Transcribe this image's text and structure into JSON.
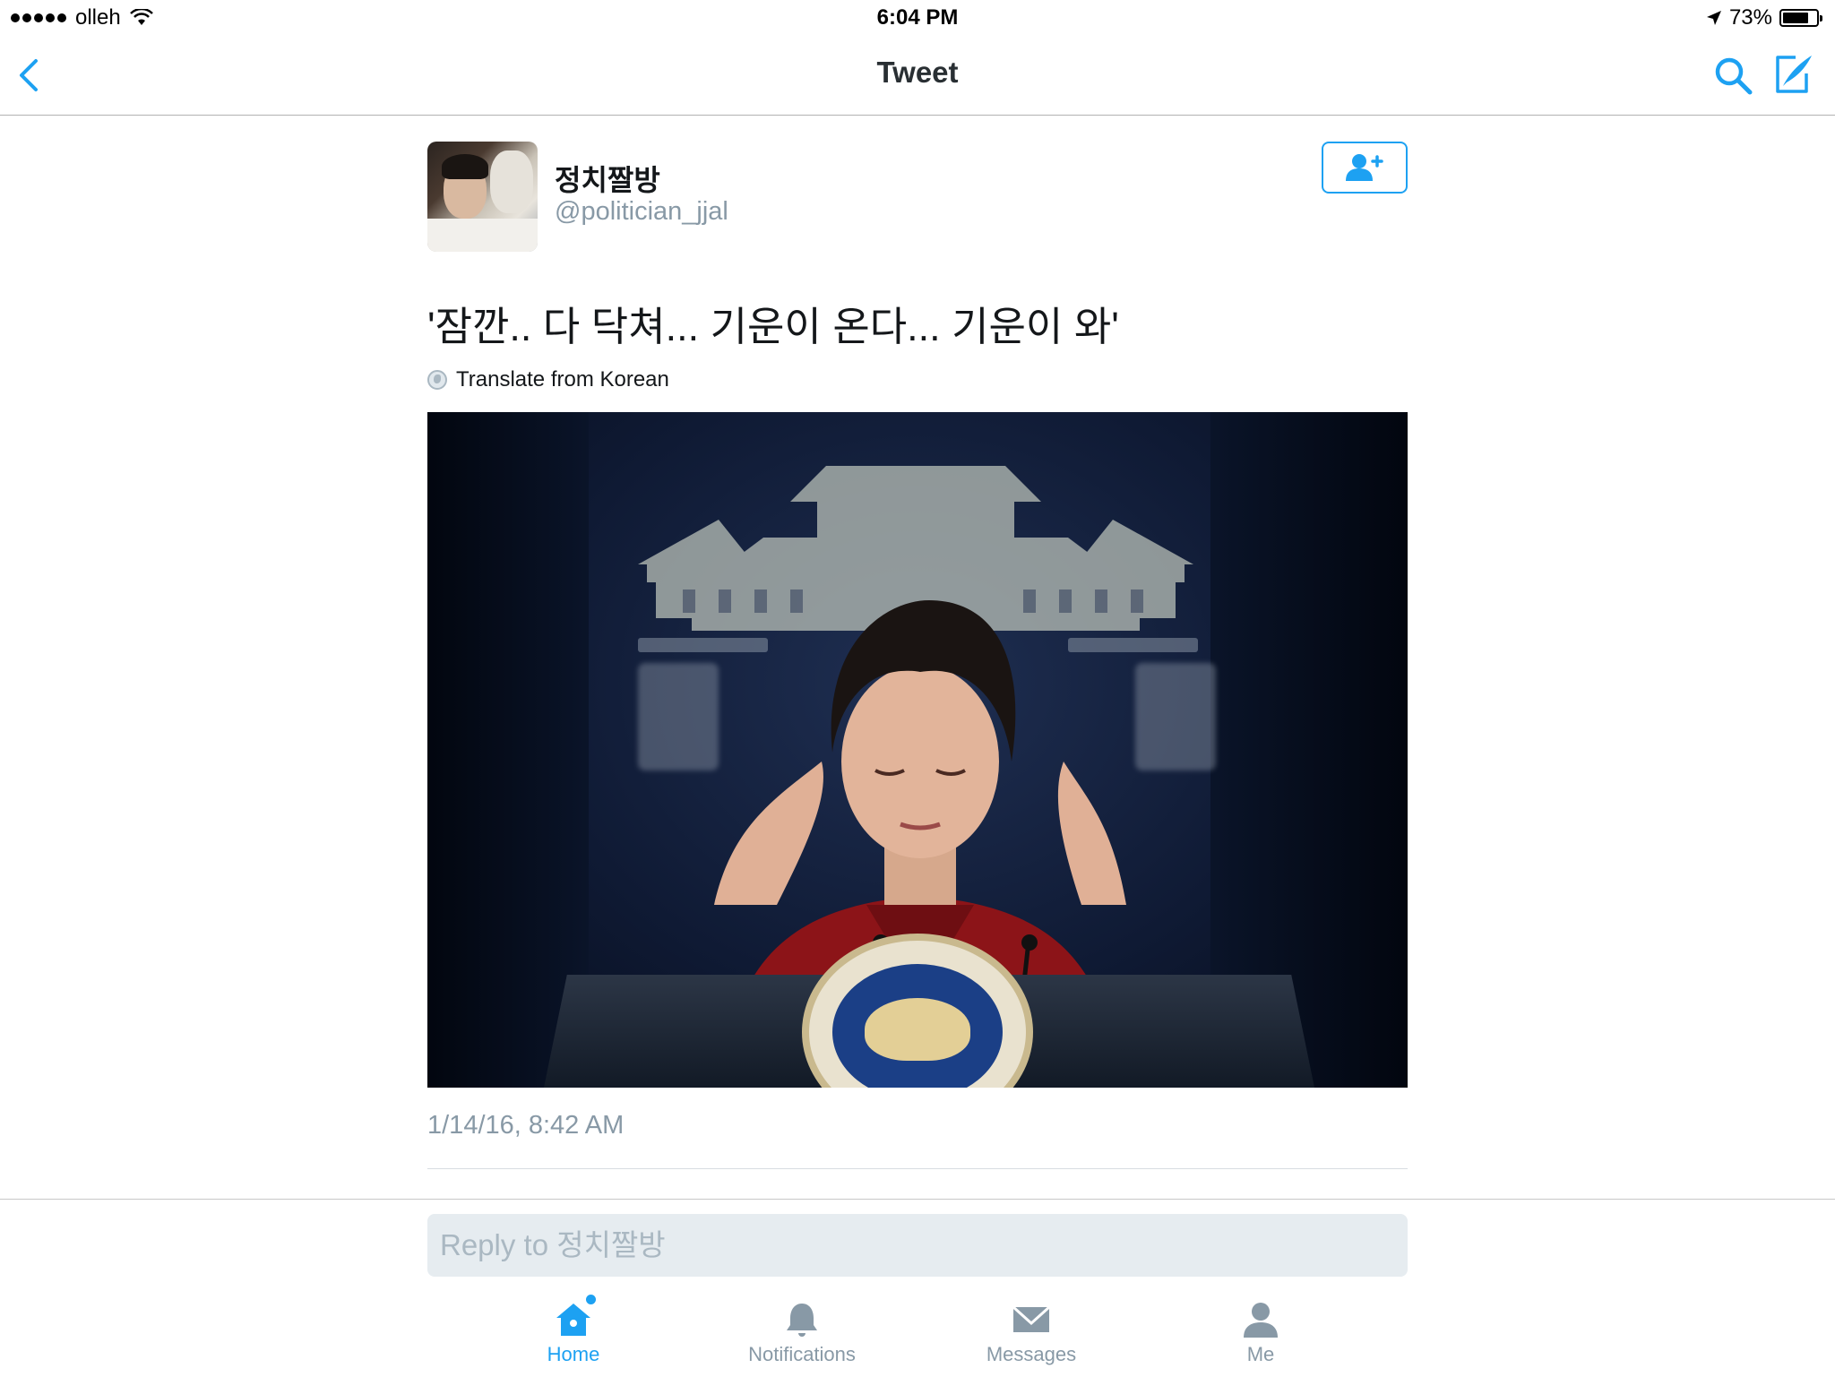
{
  "status_bar": {
    "carrier": "olleh",
    "time": "6:04 PM",
    "battery_percent": "73%",
    "battery_level": 0.73
  },
  "nav": {
    "title": "Tweet",
    "back_icon": "chevron-left-icon",
    "search_icon": "search-icon",
    "compose_icon": "compose-icon"
  },
  "tweet": {
    "author_name": "정치짤방",
    "author_handle": "@politician_jjal",
    "text": "'잠깐.. 다 닥쳐... 기운이 온다... 기운이 와'",
    "translate_label": "Translate from Korean",
    "timestamp": "1/14/16, 8:42 AM"
  },
  "reply": {
    "placeholder": "Reply to 정치짤방"
  },
  "tabs": [
    {
      "label": "Home",
      "icon": "home-icon",
      "active": true
    },
    {
      "label": "Notifications",
      "icon": "bell-icon",
      "active": false
    },
    {
      "label": "Messages",
      "icon": "envelope-icon",
      "active": false
    },
    {
      "label": "Me",
      "icon": "person-icon",
      "active": false
    }
  ],
  "colors": {
    "accent": "#1da1f2",
    "secondary_text": "#8899a6",
    "primary_text": "#14171a"
  }
}
